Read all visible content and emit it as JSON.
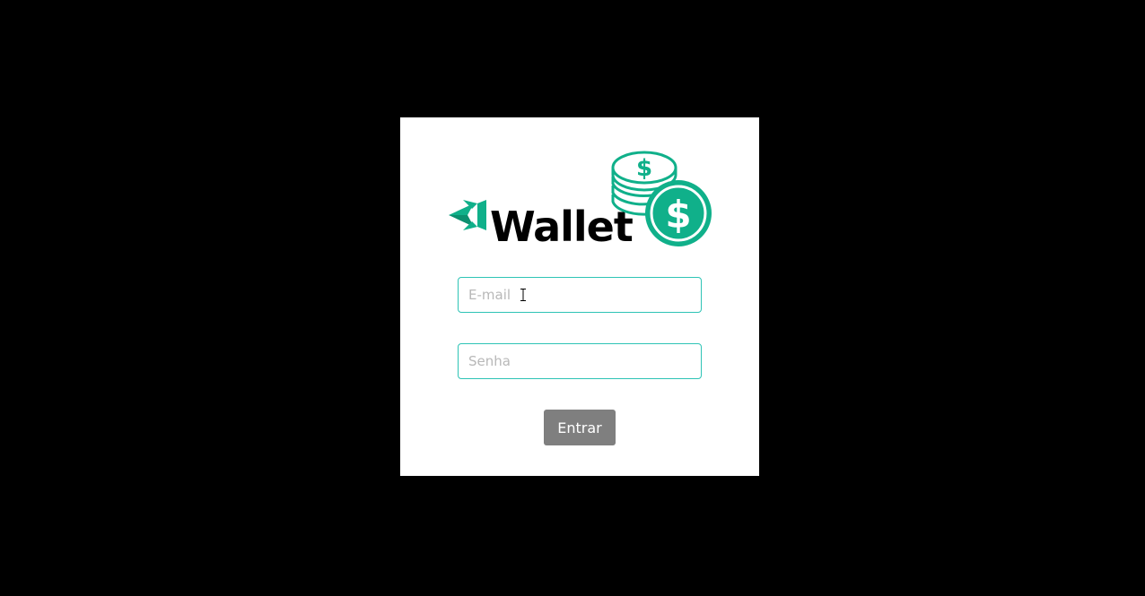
{
  "logo": {
    "text": "Wallet",
    "colors": {
      "brand": "#10b08a",
      "text": "#000000"
    },
    "icons": [
      "arrow-logo-icon",
      "coin-stack-icon",
      "dollar-coin-icon"
    ]
  },
  "form": {
    "email": {
      "placeholder": "E-mail",
      "value": ""
    },
    "senha": {
      "placeholder": "Senha",
      "value": ""
    },
    "submit_label": "Entrar"
  },
  "colors": {
    "background": "#000000",
    "card": "#ffffff",
    "input_border": "#2ec4b6",
    "button": "#7f7f7f"
  }
}
